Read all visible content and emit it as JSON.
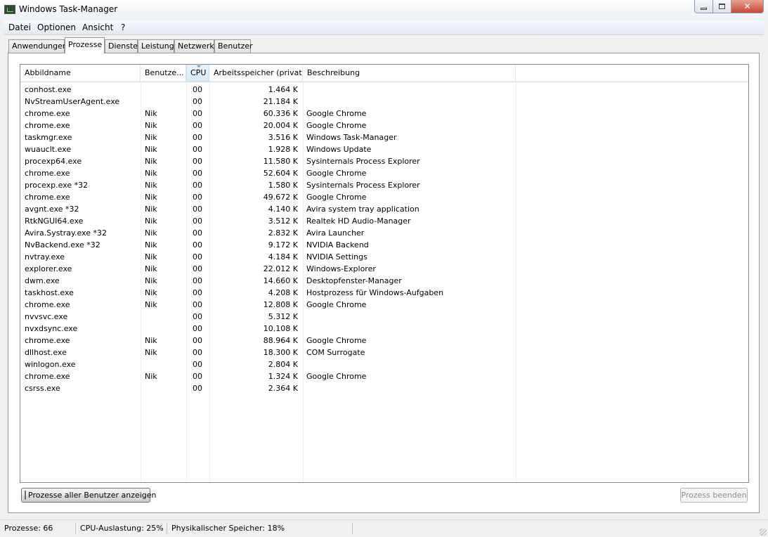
{
  "window": {
    "title": "Windows Task-Manager"
  },
  "menu": [
    "Datei",
    "Optionen",
    "Ansicht",
    "?"
  ],
  "tabs": [
    "Anwendungen",
    "Prozesse",
    "Dienste",
    "Leistung",
    "Netzwerk",
    "Benutzer"
  ],
  "active_tab": "Prozesse",
  "columns": {
    "name": "Abbildname",
    "user": "Benutze...",
    "cpu": "CPU",
    "mem": "Arbeitsspeicher (privat...",
    "desc": "Beschreibung"
  },
  "processes": [
    {
      "name": "conhost.exe",
      "user": "",
      "cpu": "00",
      "mem": "1.464 K",
      "desc": ""
    },
    {
      "name": "NvStreamUserAgent.exe",
      "user": "",
      "cpu": "00",
      "mem": "21.184 K",
      "desc": ""
    },
    {
      "name": "chrome.exe",
      "user": "Nik",
      "cpu": "00",
      "mem": "60.336 K",
      "desc": "Google Chrome"
    },
    {
      "name": "chrome.exe",
      "user": "Nik",
      "cpu": "00",
      "mem": "20.004 K",
      "desc": "Google Chrome"
    },
    {
      "name": "taskmgr.exe",
      "user": "Nik",
      "cpu": "00",
      "mem": "3.516 K",
      "desc": "Windows Task-Manager"
    },
    {
      "name": "wuauclt.exe",
      "user": "Nik",
      "cpu": "00",
      "mem": "1.928 K",
      "desc": "Windows Update"
    },
    {
      "name": "procexp64.exe",
      "user": "Nik",
      "cpu": "00",
      "mem": "11.580 K",
      "desc": "Sysinternals Process Explorer"
    },
    {
      "name": "chrome.exe",
      "user": "Nik",
      "cpu": "00",
      "mem": "52.604 K",
      "desc": "Google Chrome"
    },
    {
      "name": "procexp.exe *32",
      "user": "Nik",
      "cpu": "00",
      "mem": "1.580 K",
      "desc": "Sysinternals Process Explorer"
    },
    {
      "name": "chrome.exe",
      "user": "Nik",
      "cpu": "00",
      "mem": "49.672 K",
      "desc": "Google Chrome"
    },
    {
      "name": "avgnt.exe *32",
      "user": "Nik",
      "cpu": "00",
      "mem": "4.140 K",
      "desc": "Avira system tray application"
    },
    {
      "name": "RtkNGUI64.exe",
      "user": "Nik",
      "cpu": "00",
      "mem": "3.512 K",
      "desc": "Realtek HD Audio-Manager"
    },
    {
      "name": "Avira.Systray.exe *32",
      "user": "Nik",
      "cpu": "00",
      "mem": "2.832 K",
      "desc": "Avira Launcher"
    },
    {
      "name": "NvBackend.exe *32",
      "user": "Nik",
      "cpu": "00",
      "mem": "9.172 K",
      "desc": "NVIDIA Backend"
    },
    {
      "name": "nvtray.exe",
      "user": "Nik",
      "cpu": "00",
      "mem": "4.184 K",
      "desc": "NVIDIA Settings"
    },
    {
      "name": "explorer.exe",
      "user": "Nik",
      "cpu": "00",
      "mem": "22.012 K",
      "desc": "Windows-Explorer"
    },
    {
      "name": "dwm.exe",
      "user": "Nik",
      "cpu": "00",
      "mem": "14.660 K",
      "desc": "Desktopfenster-Manager"
    },
    {
      "name": "taskhost.exe",
      "user": "Nik",
      "cpu": "00",
      "mem": "4.208 K",
      "desc": "Hostprozess für Windows-Aufgaben"
    },
    {
      "name": "chrome.exe",
      "user": "Nik",
      "cpu": "00",
      "mem": "12.808 K",
      "desc": "Google Chrome"
    },
    {
      "name": "nvvsvc.exe",
      "user": "",
      "cpu": "00",
      "mem": "5.312 K",
      "desc": ""
    },
    {
      "name": "nvxdsync.exe",
      "user": "",
      "cpu": "00",
      "mem": "10.108 K",
      "desc": ""
    },
    {
      "name": "chrome.exe",
      "user": "Nik",
      "cpu": "00",
      "mem": "88.964 K",
      "desc": "Google Chrome"
    },
    {
      "name": "dllhost.exe",
      "user": "Nik",
      "cpu": "00",
      "mem": "18.300 K",
      "desc": "COM Surrogate"
    },
    {
      "name": "winlogon.exe",
      "user": "",
      "cpu": "00",
      "mem": "2.804 K",
      "desc": ""
    },
    {
      "name": "chrome.exe",
      "user": "Nik",
      "cpu": "00",
      "mem": "1.324 K",
      "desc": "Google Chrome"
    },
    {
      "name": "csrss.exe",
      "user": "",
      "cpu": "00",
      "mem": "2.364 K",
      "desc": ""
    }
  ],
  "buttons": {
    "show_all": "Prozesse aller Benutzer anzeigen",
    "end_process": "Prozess beenden"
  },
  "status": {
    "processes": "Prozesse: 66",
    "cpu": "CPU-Auslastung: 25%",
    "memory": "Physikalischer Speicher: 18%"
  }
}
